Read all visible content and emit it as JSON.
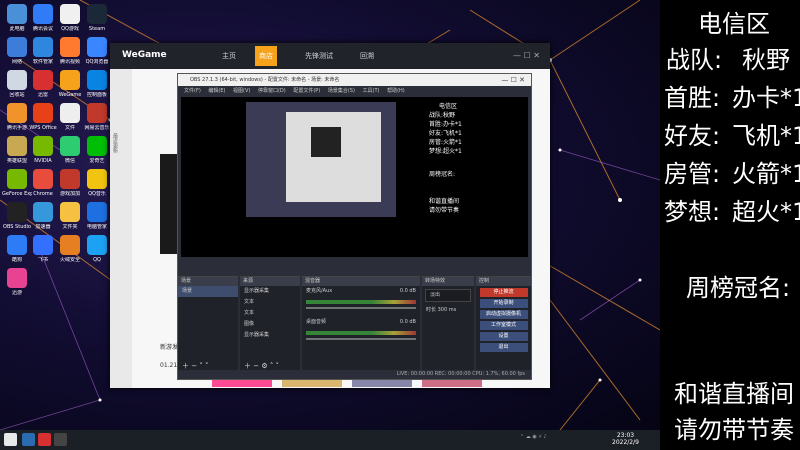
{
  "desktop": {
    "icons": [
      {
        "label": "此电脑",
        "color": "#4a90d9"
      },
      {
        "label": "腾讯会议",
        "color": "#2f7cf6"
      },
      {
        "label": "QQ游戏",
        "color": "#f0f0f0"
      },
      {
        "label": "Steam",
        "color": "#1b2838"
      },
      {
        "label": "网络",
        "color": "#3b7dd8"
      },
      {
        "label": "软件管家",
        "color": "#2e86de"
      },
      {
        "label": "腾讯视频",
        "color": "#ff7a2f"
      },
      {
        "label": "QQ浏览器",
        "color": "#3a86ff"
      },
      {
        "label": "回收站",
        "color": "#cfd8e3"
      },
      {
        "label": "迅雷",
        "color": "#d63031"
      },
      {
        "label": "WeGame",
        "color": "#f7a21b"
      },
      {
        "label": "控制面板",
        "color": "#0984e3"
      },
      {
        "label": "腾讯手游",
        "color": "#f0932b"
      },
      {
        "label": "WPS Office",
        "color": "#e84118"
      },
      {
        "label": "文件",
        "color": "#eeeeee"
      },
      {
        "label": "网易云音乐",
        "color": "#c0392b"
      },
      {
        "label": "英雄联盟",
        "color": "#c8a951"
      },
      {
        "label": "NVIDIA",
        "color": "#76b900"
      },
      {
        "label": "微信",
        "color": "#2ecc71"
      },
      {
        "label": "爱奇艺",
        "color": "#00be06"
      },
      {
        "label": "GeForce Experience",
        "color": "#76b900"
      },
      {
        "label": "Chrome",
        "color": "#e74c3c"
      },
      {
        "label": "游戏加加",
        "color": "#c0392b"
      },
      {
        "label": "QQ音乐",
        "color": "#f1c40f"
      },
      {
        "label": "OBS Studio",
        "color": "#222222"
      },
      {
        "label": "加速器",
        "color": "#3498db"
      },
      {
        "label": "文件夹",
        "color": "#f6c142"
      },
      {
        "label": "电脑管家",
        "color": "#1e6fe0"
      },
      {
        "label": "酷狗",
        "color": "#2d7cf6"
      },
      {
        "label": "飞书",
        "color": "#3370ff"
      },
      {
        "label": "火绒安全",
        "color": "#e67e22"
      },
      {
        "label": "QQ",
        "color": "#1da1f2"
      },
      {
        "label": "迅游",
        "color": "#e84393"
      }
    ]
  },
  "wegame": {
    "logo": "WeGame",
    "tabs": [
      "主页",
      "商店",
      "先锋测试",
      "回溯"
    ],
    "active_tab": "商店",
    "side_label": "最近更新",
    "content_texts": [
      "新游发",
      "01.21"
    ]
  },
  "obs": {
    "title": "OBS 27.1.3 (64-bit, windows) - 配置文件: 未命名 - 场景: 未命名",
    "menu": [
      "文件(F)",
      "编辑(E)",
      "视图(V)",
      "停靠窗口(D)",
      "配置文件(P)",
      "场景集合(S)",
      "工具(T)",
      "帮助(H)"
    ],
    "panels": {
      "scenes": {
        "title": "场景",
        "items": [
          "场景"
        ]
      },
      "sources": {
        "title": "来源",
        "items": [
          "显示器采集",
          "文本",
          "文本",
          "图像",
          "显示器采集"
        ]
      },
      "mixer": {
        "title": "混音器",
        "channels": [
          {
            "name": "麦克风/Aux",
            "db": "0.0 dB"
          },
          {
            "name": "桌面音频",
            "db": "0.0 dB"
          }
        ]
      },
      "transitions": {
        "title": "转场特效",
        "type": "淡出",
        "duration_label": "时长",
        "duration": "300 ms"
      },
      "controls": {
        "title": "控制",
        "buttons": [
          "停止推流",
          "开始录制",
          "启动虚拟摄像机",
          "工作室模式",
          "设置",
          "退出"
        ]
      }
    },
    "status": "LIVE: 00:00:00   REC: 00:00:00   CPU: 1.7%, 60.00 fps"
  },
  "overlay": {
    "region": "电信区",
    "team_label": "战队:",
    "team_value": "秋野",
    "first_label": "首胜:",
    "first_value": "办卡*1",
    "friend_label": "好友:",
    "friend_value": "飞机*1",
    "admin_label": "房管:",
    "admin_value": "火箭*1",
    "dream_label": "梦想:",
    "dream_value": "超火*1",
    "weekly_title": "周榜冠名:",
    "notice_line1": "和谐直播间",
    "notice_line2": "请勿带节奏"
  },
  "taskbar": {
    "time": "23:03",
    "date": "2022/2/9"
  }
}
